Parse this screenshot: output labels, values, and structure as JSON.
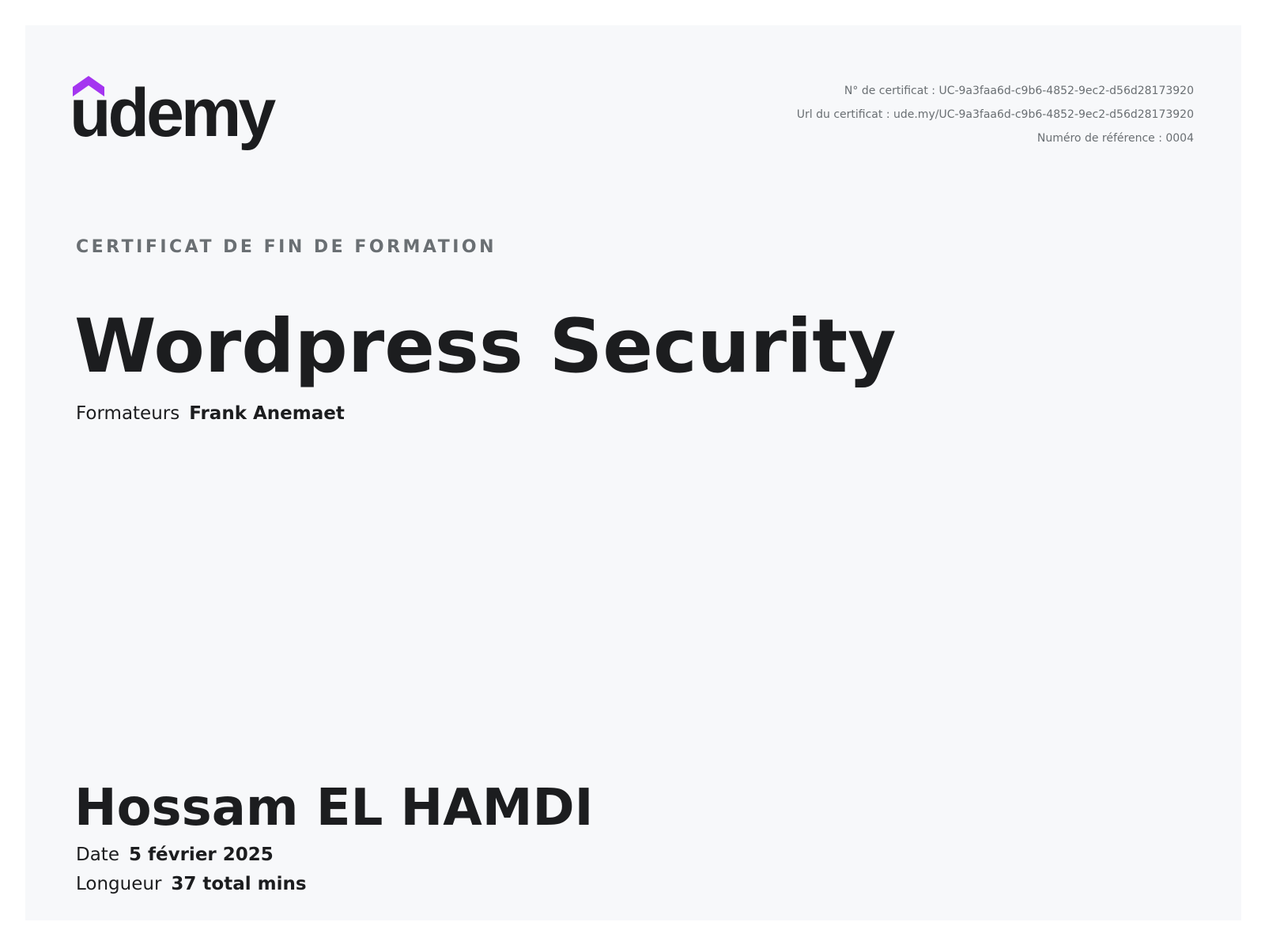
{
  "brand": {
    "logo_text": "udemy",
    "accent_color": "#a435f0",
    "text_color": "#1c1d1f"
  },
  "certificate_info": {
    "number": "N° de certificat : UC-9a3faa6d-c9b6-4852-9ec2-d56d28173920",
    "url": "Url du certificat : ude.my/UC-9a3faa6d-c9b6-4852-9ec2-d56d28173920",
    "reference": "Numéro de référence : 0004"
  },
  "kicker": "CERTIFICAT DE FIN DE FORMATION",
  "course_title": "Wordpress Security",
  "instructors": {
    "label": "Formateurs",
    "name": "Frank Anemaet"
  },
  "student_name": "Hossam EL HAMDI",
  "date": {
    "label": "Date",
    "value": "5 février 2025"
  },
  "length": {
    "label": "Longueur",
    "value": "37 total mins"
  }
}
